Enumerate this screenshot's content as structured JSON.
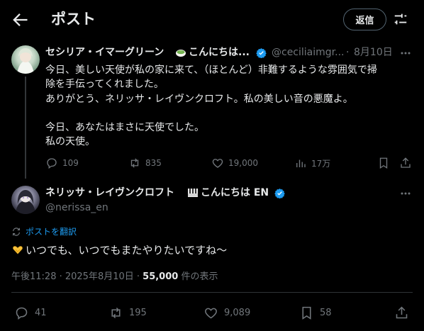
{
  "header": {
    "title": "ポスト",
    "reply_label": "返信"
  },
  "colors": {
    "accent": "#1d9bf0",
    "text": "#e7e9ea",
    "muted": "#71767b",
    "background": "#000000"
  },
  "parent_post": {
    "display_name": "セシリア・イマーグリーン",
    "name_suffix": "こんにちは...",
    "name_emoji": "matcha-icon",
    "handle": "@ceciliaimgr...",
    "separator": "·",
    "date": "8月10日",
    "body_lines": [
      "今日、美しい天使が私の家に来て、（ほとんど）非難するような雰囲気で掃",
      "除を手伝ってくれました。",
      "ありがとう、ネリッサ・レイヴンクロフト。私の美しい音の悪魔よ。",
      "",
      "今日、あなたはまさに天使でした。",
      "私の天使。"
    ],
    "stats": {
      "replies": "109",
      "reposts": "835",
      "likes": "19,000",
      "views": "17万"
    }
  },
  "main_post": {
    "display_name": "ネリッサ・レイヴンクロフト",
    "name_suffix": "こんにちは EN",
    "name_emoji": "piano-keys-icon",
    "handle": "@nerissa_en",
    "translate_label": "ポストを翻訳",
    "text_emoji": "heart-hands-icon",
    "text": "いつでも、いつでもまたやりたいですね～",
    "timestamp": "午後11:28 · 2025年8月10日 · ",
    "views_count": "55,000",
    "views_label": " 件の表示",
    "stats": {
      "replies": "41",
      "reposts": "195",
      "likes": "9,089",
      "bookmarks": "58"
    }
  }
}
